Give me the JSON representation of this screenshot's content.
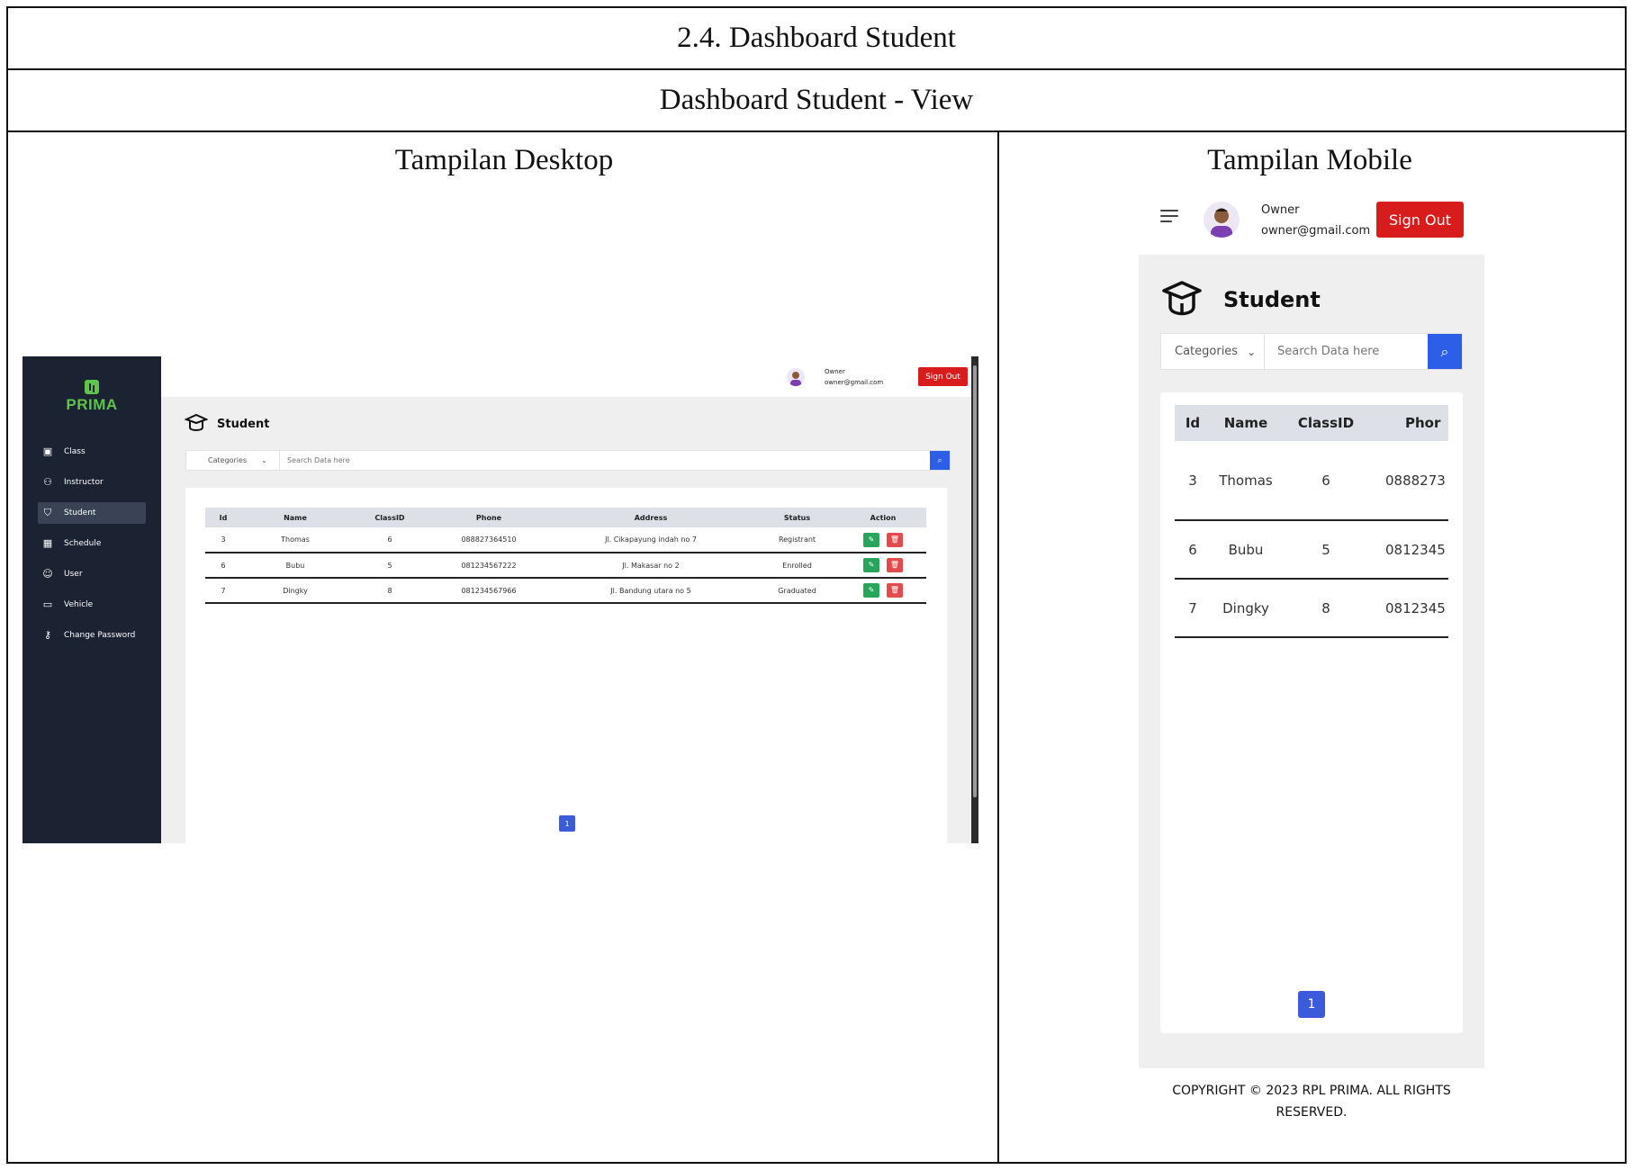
{
  "document": {
    "title": "2.4. Dashboard Student",
    "subtitle": "Dashboard Student - View",
    "desktop_heading": "Tampilan Desktop",
    "mobile_heading": "Tampilan Mobile"
  },
  "app": {
    "brand": "PRIMA",
    "brand_color": "#5ec44a",
    "sidebar": {
      "items": [
        {
          "label": "Class",
          "icon": "class-icon"
        },
        {
          "label": "Instructor",
          "icon": "instructor-icon"
        },
        {
          "label": "Student",
          "icon": "student-cap-icon",
          "active": true
        },
        {
          "label": "Schedule",
          "icon": "calendar-icon"
        },
        {
          "label": "User",
          "icon": "user-icon"
        },
        {
          "label": "Vehicle",
          "icon": "car-icon"
        },
        {
          "label": "Change Password",
          "icon": "key-icon"
        }
      ]
    },
    "user": {
      "name": "Owner",
      "email": "owner@gmail.com"
    },
    "signout_label": "Sign Out",
    "signout_color": "#d81b1b",
    "page_title": "Student",
    "search": {
      "category_label": "Categories",
      "placeholder": "Search Data here"
    },
    "table": {
      "columns": [
        "Id",
        "Name",
        "ClassID",
        "Phone",
        "Address",
        "Status",
        "Action"
      ],
      "rows": [
        {
          "id": "3",
          "name": "Thomas",
          "class_id": "6",
          "phone": "088827364510",
          "address": "Jl. Cikapayung indah no 7",
          "status": "Registrant"
        },
        {
          "id": "6",
          "name": "Bubu",
          "class_id": "5",
          "phone": "081234567222",
          "address": "Jl. Makasar no 2",
          "status": "Enrolled"
        },
        {
          "id": "7",
          "name": "Dingky",
          "class_id": "8",
          "phone": "081234567966",
          "address": "Jl. Bandung utara no 5",
          "status": "Graduated"
        }
      ]
    },
    "pagination": {
      "current": "1"
    },
    "mobile": {
      "phone_header_visible": "Phor",
      "phones_visible": [
        "0888273",
        "0812345",
        "0812345"
      ]
    },
    "footer": "COPYRIGHT © 2023 RPL PRIMA. ALL RIGHTS RESERVED."
  }
}
